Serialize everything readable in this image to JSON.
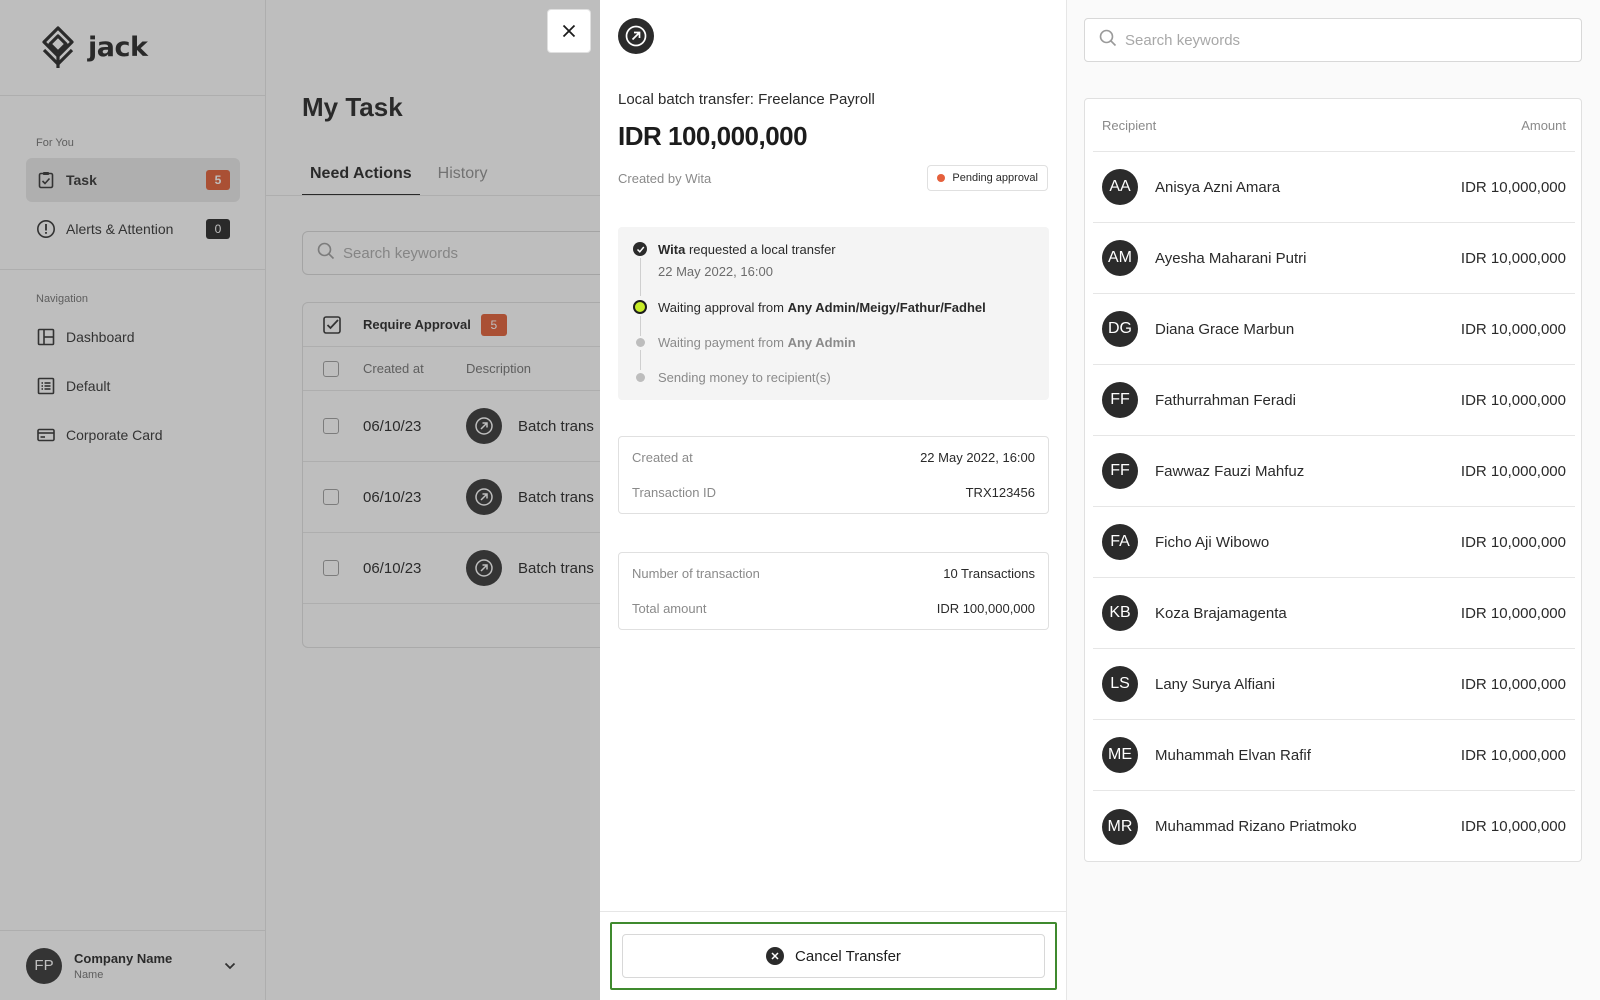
{
  "brand": {
    "name": "jack"
  },
  "sidebar": {
    "sections": [
      {
        "label": "For You"
      },
      {
        "label": "Navigation"
      }
    ],
    "for_you": [
      {
        "label": "Task",
        "badge": "5"
      },
      {
        "label": "Alerts & Attention",
        "badge": "0"
      }
    ],
    "navigation": [
      {
        "label": "Dashboard"
      },
      {
        "label": "Default"
      },
      {
        "label": "Corporate Card"
      }
    ],
    "company": {
      "initials": "FP",
      "name": "Company Name",
      "sub": "Name"
    }
  },
  "main": {
    "title": "My Task",
    "tabs": [
      {
        "label": "Need Actions"
      },
      {
        "label": "History"
      }
    ],
    "search_placeholder": "Search keywords",
    "table": {
      "group_label": "Require Approval",
      "group_count": "5",
      "columns": [
        "Created at",
        "Description"
      ],
      "rows": [
        {
          "date": "06/10/23",
          "desc": "Batch trans"
        },
        {
          "date": "06/10/23",
          "desc": "Batch trans"
        },
        {
          "date": "06/10/23",
          "desc": "Batch trans"
        }
      ]
    }
  },
  "detail": {
    "subtitle": "Local batch transfer: Freelance Payroll",
    "amount": "IDR 100,000,000",
    "created_by": "Created by Wita",
    "status": "Pending approval",
    "timeline": [
      {
        "actor": "Wita",
        "text": " requested a local transfer",
        "time": "22 May 2022, 16:00"
      },
      {
        "prefix": "Waiting approval from ",
        "actor": "Any Admin/Meigy/Fathur/Fadhel"
      },
      {
        "prefix": "Waiting payment from ",
        "actor": "Any Admin"
      },
      {
        "text": "Sending money to recipient(s)"
      }
    ],
    "info": [
      {
        "label": "Created at",
        "value": "22 May 2022, 16:00"
      },
      {
        "label": "Transaction ID",
        "value": "TRX123456"
      }
    ],
    "summary": [
      {
        "label": "Number of transaction",
        "value": "10 Transactions"
      },
      {
        "label": "Total amount",
        "value": "IDR 100,000,000"
      }
    ],
    "cancel_label": "Cancel Transfer"
  },
  "recipients": {
    "search_placeholder": "Search keywords",
    "header": {
      "recipient": "Recipient",
      "amount": "Amount"
    },
    "rows": [
      {
        "initials": "AA",
        "name": "Anisya Azni Amara",
        "amount": "IDR 10,000,000"
      },
      {
        "initials": "AM",
        "name": "Ayesha Maharani Putri",
        "amount": "IDR 10,000,000"
      },
      {
        "initials": "DG",
        "name": "Diana Grace Marbun",
        "amount": "IDR 10,000,000"
      },
      {
        "initials": "FF",
        "name": "Fathurrahman Feradi",
        "amount": "IDR 10,000,000"
      },
      {
        "initials": "FF",
        "name": "Fawwaz Fauzi Mahfuz",
        "amount": "IDR 10,000,000"
      },
      {
        "initials": "FA",
        "name": "Ficho Aji Wibowo",
        "amount": "IDR 10,000,000"
      },
      {
        "initials": "KB",
        "name": "Koza Brajamagenta",
        "amount": "IDR 10,000,000"
      },
      {
        "initials": "LS",
        "name": "Lany Surya Alfiani",
        "amount": "IDR 10,000,000"
      },
      {
        "initials": "ME",
        "name": "Muhammah Elvan Rafif",
        "amount": "IDR 10,000,000"
      },
      {
        "initials": "MR",
        "name": "Muhammad Rizano Priatmoko",
        "amount": "IDR 10,000,000"
      }
    ]
  },
  "colors": {
    "accent_orange": "#e0572b",
    "status_red": "#e5603c",
    "active_lime": "#c7ec28",
    "focus_green": "#3f8a2e"
  }
}
